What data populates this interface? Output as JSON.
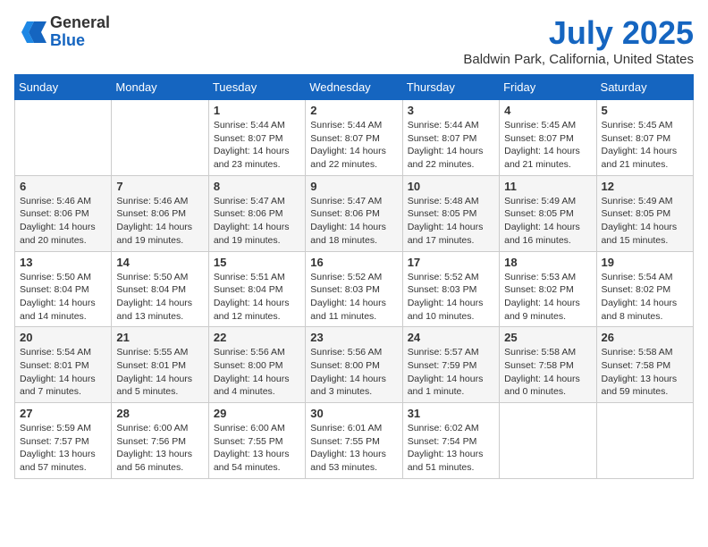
{
  "header": {
    "logo": {
      "line1": "General",
      "line2": "Blue"
    },
    "title": "July 2025",
    "location": "Baldwin Park, California, United States"
  },
  "days_of_week": [
    "Sunday",
    "Monday",
    "Tuesday",
    "Wednesday",
    "Thursday",
    "Friday",
    "Saturday"
  ],
  "weeks": [
    [
      {
        "day": null,
        "content": null
      },
      {
        "day": null,
        "content": null
      },
      {
        "day": "1",
        "content": "Sunrise: 5:44 AM\nSunset: 8:07 PM\nDaylight: 14 hours and 23 minutes."
      },
      {
        "day": "2",
        "content": "Sunrise: 5:44 AM\nSunset: 8:07 PM\nDaylight: 14 hours and 22 minutes."
      },
      {
        "day": "3",
        "content": "Sunrise: 5:44 AM\nSunset: 8:07 PM\nDaylight: 14 hours and 22 minutes."
      },
      {
        "day": "4",
        "content": "Sunrise: 5:45 AM\nSunset: 8:07 PM\nDaylight: 14 hours and 21 minutes."
      },
      {
        "day": "5",
        "content": "Sunrise: 5:45 AM\nSunset: 8:07 PM\nDaylight: 14 hours and 21 minutes."
      }
    ],
    [
      {
        "day": "6",
        "content": "Sunrise: 5:46 AM\nSunset: 8:06 PM\nDaylight: 14 hours and 20 minutes."
      },
      {
        "day": "7",
        "content": "Sunrise: 5:46 AM\nSunset: 8:06 PM\nDaylight: 14 hours and 19 minutes."
      },
      {
        "day": "8",
        "content": "Sunrise: 5:47 AM\nSunset: 8:06 PM\nDaylight: 14 hours and 19 minutes."
      },
      {
        "day": "9",
        "content": "Sunrise: 5:47 AM\nSunset: 8:06 PM\nDaylight: 14 hours and 18 minutes."
      },
      {
        "day": "10",
        "content": "Sunrise: 5:48 AM\nSunset: 8:05 PM\nDaylight: 14 hours and 17 minutes."
      },
      {
        "day": "11",
        "content": "Sunrise: 5:49 AM\nSunset: 8:05 PM\nDaylight: 14 hours and 16 minutes."
      },
      {
        "day": "12",
        "content": "Sunrise: 5:49 AM\nSunset: 8:05 PM\nDaylight: 14 hours and 15 minutes."
      }
    ],
    [
      {
        "day": "13",
        "content": "Sunrise: 5:50 AM\nSunset: 8:04 PM\nDaylight: 14 hours and 14 minutes."
      },
      {
        "day": "14",
        "content": "Sunrise: 5:50 AM\nSunset: 8:04 PM\nDaylight: 14 hours and 13 minutes."
      },
      {
        "day": "15",
        "content": "Sunrise: 5:51 AM\nSunset: 8:04 PM\nDaylight: 14 hours and 12 minutes."
      },
      {
        "day": "16",
        "content": "Sunrise: 5:52 AM\nSunset: 8:03 PM\nDaylight: 14 hours and 11 minutes."
      },
      {
        "day": "17",
        "content": "Sunrise: 5:52 AM\nSunset: 8:03 PM\nDaylight: 14 hours and 10 minutes."
      },
      {
        "day": "18",
        "content": "Sunrise: 5:53 AM\nSunset: 8:02 PM\nDaylight: 14 hours and 9 minutes."
      },
      {
        "day": "19",
        "content": "Sunrise: 5:54 AM\nSunset: 8:02 PM\nDaylight: 14 hours and 8 minutes."
      }
    ],
    [
      {
        "day": "20",
        "content": "Sunrise: 5:54 AM\nSunset: 8:01 PM\nDaylight: 14 hours and 7 minutes."
      },
      {
        "day": "21",
        "content": "Sunrise: 5:55 AM\nSunset: 8:01 PM\nDaylight: 14 hours and 5 minutes."
      },
      {
        "day": "22",
        "content": "Sunrise: 5:56 AM\nSunset: 8:00 PM\nDaylight: 14 hours and 4 minutes."
      },
      {
        "day": "23",
        "content": "Sunrise: 5:56 AM\nSunset: 8:00 PM\nDaylight: 14 hours and 3 minutes."
      },
      {
        "day": "24",
        "content": "Sunrise: 5:57 AM\nSunset: 7:59 PM\nDaylight: 14 hours and 1 minute."
      },
      {
        "day": "25",
        "content": "Sunrise: 5:58 AM\nSunset: 7:58 PM\nDaylight: 14 hours and 0 minutes."
      },
      {
        "day": "26",
        "content": "Sunrise: 5:58 AM\nSunset: 7:58 PM\nDaylight: 13 hours and 59 minutes."
      }
    ],
    [
      {
        "day": "27",
        "content": "Sunrise: 5:59 AM\nSunset: 7:57 PM\nDaylight: 13 hours and 57 minutes."
      },
      {
        "day": "28",
        "content": "Sunrise: 6:00 AM\nSunset: 7:56 PM\nDaylight: 13 hours and 56 minutes."
      },
      {
        "day": "29",
        "content": "Sunrise: 6:00 AM\nSunset: 7:55 PM\nDaylight: 13 hours and 54 minutes."
      },
      {
        "day": "30",
        "content": "Sunrise: 6:01 AM\nSunset: 7:55 PM\nDaylight: 13 hours and 53 minutes."
      },
      {
        "day": "31",
        "content": "Sunrise: 6:02 AM\nSunset: 7:54 PM\nDaylight: 13 hours and 51 minutes."
      },
      {
        "day": null,
        "content": null
      },
      {
        "day": null,
        "content": null
      }
    ]
  ]
}
